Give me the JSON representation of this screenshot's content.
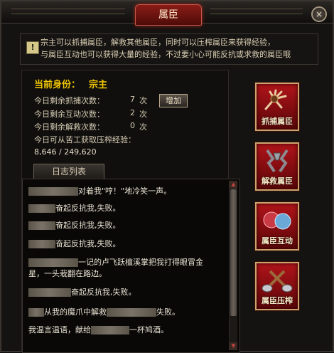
{
  "window": {
    "title": "属臣",
    "close_label": "×"
  },
  "notice": {
    "icon": "!",
    "line1": "宗主可以抓捕属臣，解救其他属臣，同时可以压榨属臣来获得经验，",
    "line2": "与属臣互动也可以获得大量的经验，不过要小心可能反抗或求救的属臣哦"
  },
  "identity": {
    "label": "当前身份：",
    "value": "宗主"
  },
  "stats": [
    {
      "label": "今日剩余抓捕次数：",
      "value": "7",
      "unit": "次"
    },
    {
      "label": "今日剩余互动次数：",
      "value": "2",
      "unit": "次"
    },
    {
      "label": "今日剩余解救次数：",
      "value": "0",
      "unit": "次"
    }
  ],
  "add_button": "增加",
  "exp": {
    "label": "今日可从苦工获取压榨经验：",
    "value": "8,646 / 249,620"
  },
  "log_tab": "日志列表",
  "log_entries": [
    {
      "text": "对着我\"哼！\"地冷笑一声。"
    },
    {
      "text": "奋起反抗我,失败。"
    },
    {
      "text": "奋起反抗我,失败。"
    },
    {
      "text": "奋起反抗我,失败。"
    },
    {
      "text": "一记的卢飞跃檀溪掌把我打得眼冒金"
    },
    {
      "text": "星，一头栽翻在路边。"
    },
    {
      "text": "奋起反抗我,失败。"
    },
    {
      "text_a": "从我的魔爪中解救",
      "text_b": "失败。"
    },
    {
      "text_a": "我温言温语，献给",
      "text_b": "一杯鸠酒。"
    }
  ],
  "actions": [
    {
      "label": "抓捕属臣",
      "icon": "claw-icon"
    },
    {
      "label": "解救属臣",
      "icon": "broken-chain-icon"
    },
    {
      "label": "属臣互动",
      "icon": "interact-orbs-icon"
    },
    {
      "label": "属臣压榨",
      "icon": "shovels-icon"
    }
  ],
  "colors": {
    "accent": "#f0c600",
    "action_red": "#b0141a",
    "border_gold": "#caa46e"
  }
}
